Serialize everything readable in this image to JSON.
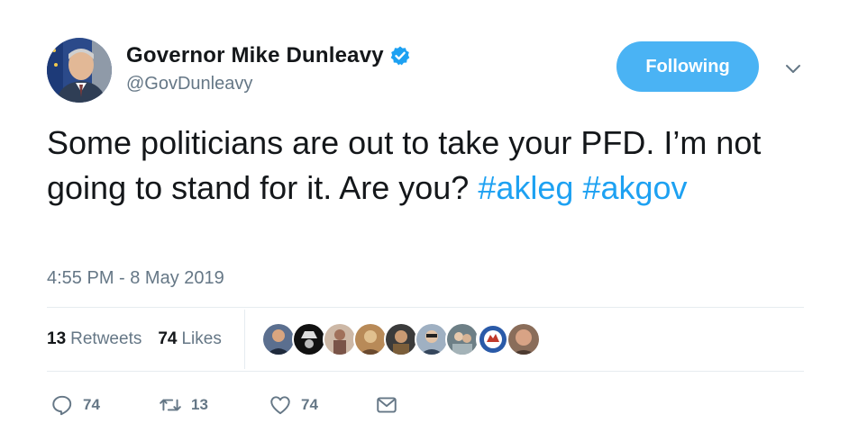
{
  "author": {
    "display_name": "Governor Mike Dunleavy",
    "handle": "@GovDunleavy",
    "verified_icon": "verified-badge-icon",
    "avatar_icon": "profile-avatar"
  },
  "follow_button": {
    "label": "Following",
    "color": "#4ab3f4"
  },
  "menu_caret": "chevron-down-icon",
  "tweet": {
    "text_main": "Some politicians are out to take your PFD. I’m not going to stand for it. Are you?",
    "hashtags": [
      "#akleg",
      "#akgov"
    ]
  },
  "timestamp": "4:55 PM - 8 May 2019",
  "stats": {
    "retweets_count": "13",
    "retweets_label": "Retweets",
    "likes_count": "74",
    "likes_label": "Likes"
  },
  "likers_count_shown": 9,
  "actions": {
    "reply_count": "74",
    "retweet_count": "13",
    "like_count": "74"
  },
  "colors": {
    "link": "#1da1f2",
    "secondary_text": "#657786",
    "primary_text": "#14171a"
  }
}
